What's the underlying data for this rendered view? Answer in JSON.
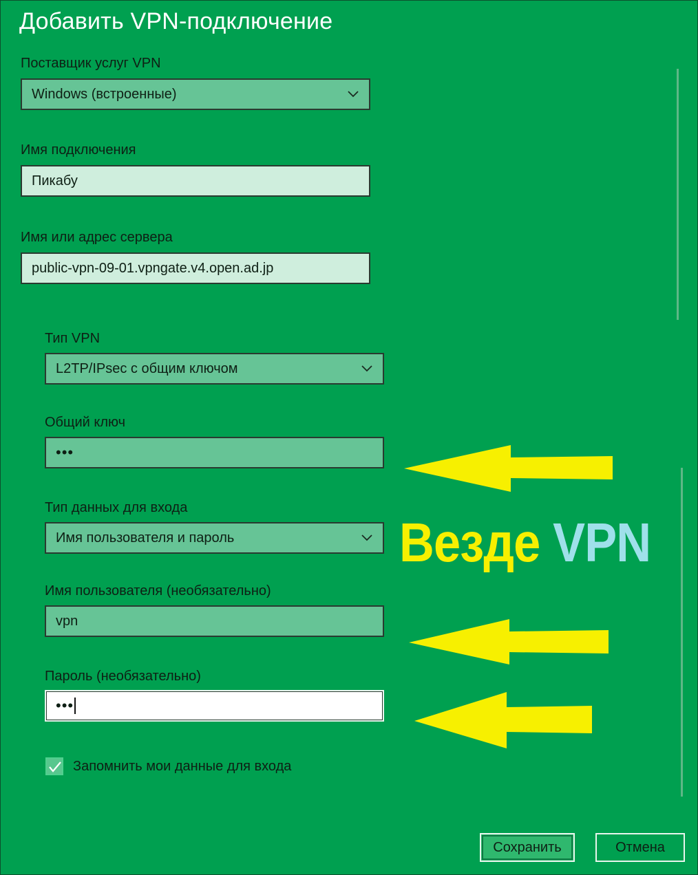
{
  "dialog": {
    "title": "Добавить VPN-подключение"
  },
  "fields": {
    "provider": {
      "label": "Поставщик услуг VPN",
      "value": "Windows (встроенные)"
    },
    "connection_name": {
      "label": "Имя подключения",
      "value": "Пикабу"
    },
    "server": {
      "label": "Имя или адрес сервера",
      "value": "public-vpn-09-01.vpngate.v4.open.ad.jp"
    },
    "vpn_type": {
      "label": "Тип VPN",
      "value": "L2TP/IPsec с общим ключом"
    },
    "shared_key": {
      "label": "Общий ключ",
      "value": "•••"
    },
    "signin_type": {
      "label": "Тип данных для входа",
      "value": "Имя пользователя и пароль"
    },
    "username": {
      "label": "Имя пользователя (необязательно)",
      "value": "vpn"
    },
    "password": {
      "label": "Пароль (необязательно)",
      "value": "•••"
    }
  },
  "remember": {
    "label": "Запомнить мои данные для входа",
    "checked": true
  },
  "buttons": {
    "save": "Сохранить",
    "cancel": "Отмена"
  },
  "overlay": {
    "slogan_word1": "Везде",
    "slogan_word2": "VPN",
    "slogan_color1": "#f7f000",
    "slogan_color2": "#9fe0ea",
    "arrow_color": "#f7f000"
  },
  "icons": {
    "dropdown": "chevron-down-icon",
    "check": "checkmark-icon",
    "arrow": "arrow-left-icon"
  }
}
